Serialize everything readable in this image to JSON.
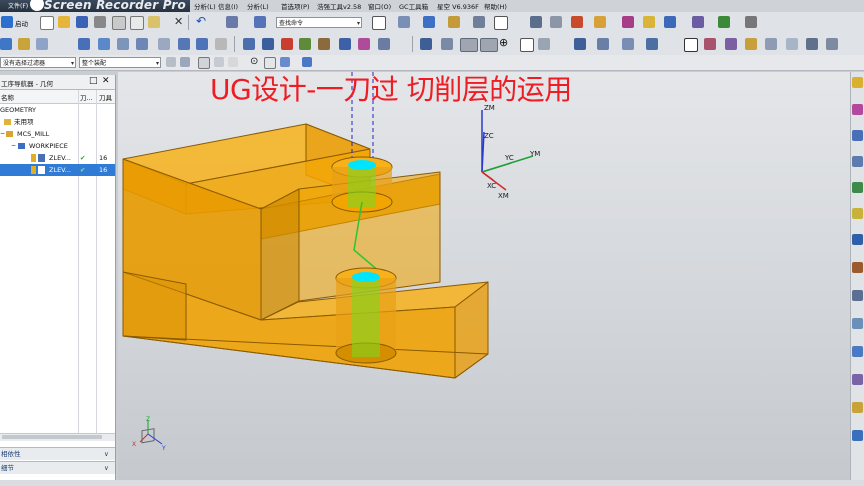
{
  "watermark": "Screen Recorder Pro",
  "menu": {
    "file": "文件(F)",
    "items": [
      "分析(L)",
      "信息(I)",
      "分析(L)",
      "首选项(P)",
      "浩强工具v2.58",
      "窗口(O)",
      "GC工具箱",
      "星空 V6.936F",
      "帮助(H)"
    ]
  },
  "toolbar": {
    "start_label": "启动",
    "find_command_placeholder": "查找命令",
    "filter_label": "没有选择过滤器",
    "assembly_label": "整个装配"
  },
  "navigator": {
    "title": "工序导航器 - 几何",
    "columns": {
      "name": "名称",
      "tool": "刀...",
      "path": "刀具"
    },
    "rows": [
      {
        "name": "GEOMETRY",
        "tool": "",
        "path": "",
        "indent": 0
      },
      {
        "name": "未用项",
        "tool": "",
        "path": "",
        "indent": 1
      },
      {
        "name": "MCS_MILL",
        "tool": "",
        "path": "",
        "indent": 1
      },
      {
        "name": "WORKPIECE",
        "tool": "",
        "path": "",
        "indent": 2
      },
      {
        "name": "ZLEV...",
        "tool": "✔",
        "path": "16",
        "indent": 3
      },
      {
        "name": "ZLEV...",
        "tool": "✔",
        "path": "16",
        "indent": 3
      }
    ],
    "bottom": [
      "相依性",
      "细节"
    ]
  },
  "viewport": {
    "title": "UG设计-一刀过 切削层的运用",
    "axes": {
      "zm": "ZM",
      "zc": "ZC",
      "yc": "YC",
      "ym": "YM",
      "xc": "XC",
      "xm": "XM"
    },
    "triad": {
      "z": "Z",
      "y": "Y",
      "x": "X"
    }
  },
  "colors": {
    "title": "#ee1d24",
    "part_fill": "#f0a000",
    "part_edge": "#8a5a00",
    "hole_top": "#00e5ff",
    "tool": "#7cd81e",
    "selection": "#2f7bd6"
  }
}
